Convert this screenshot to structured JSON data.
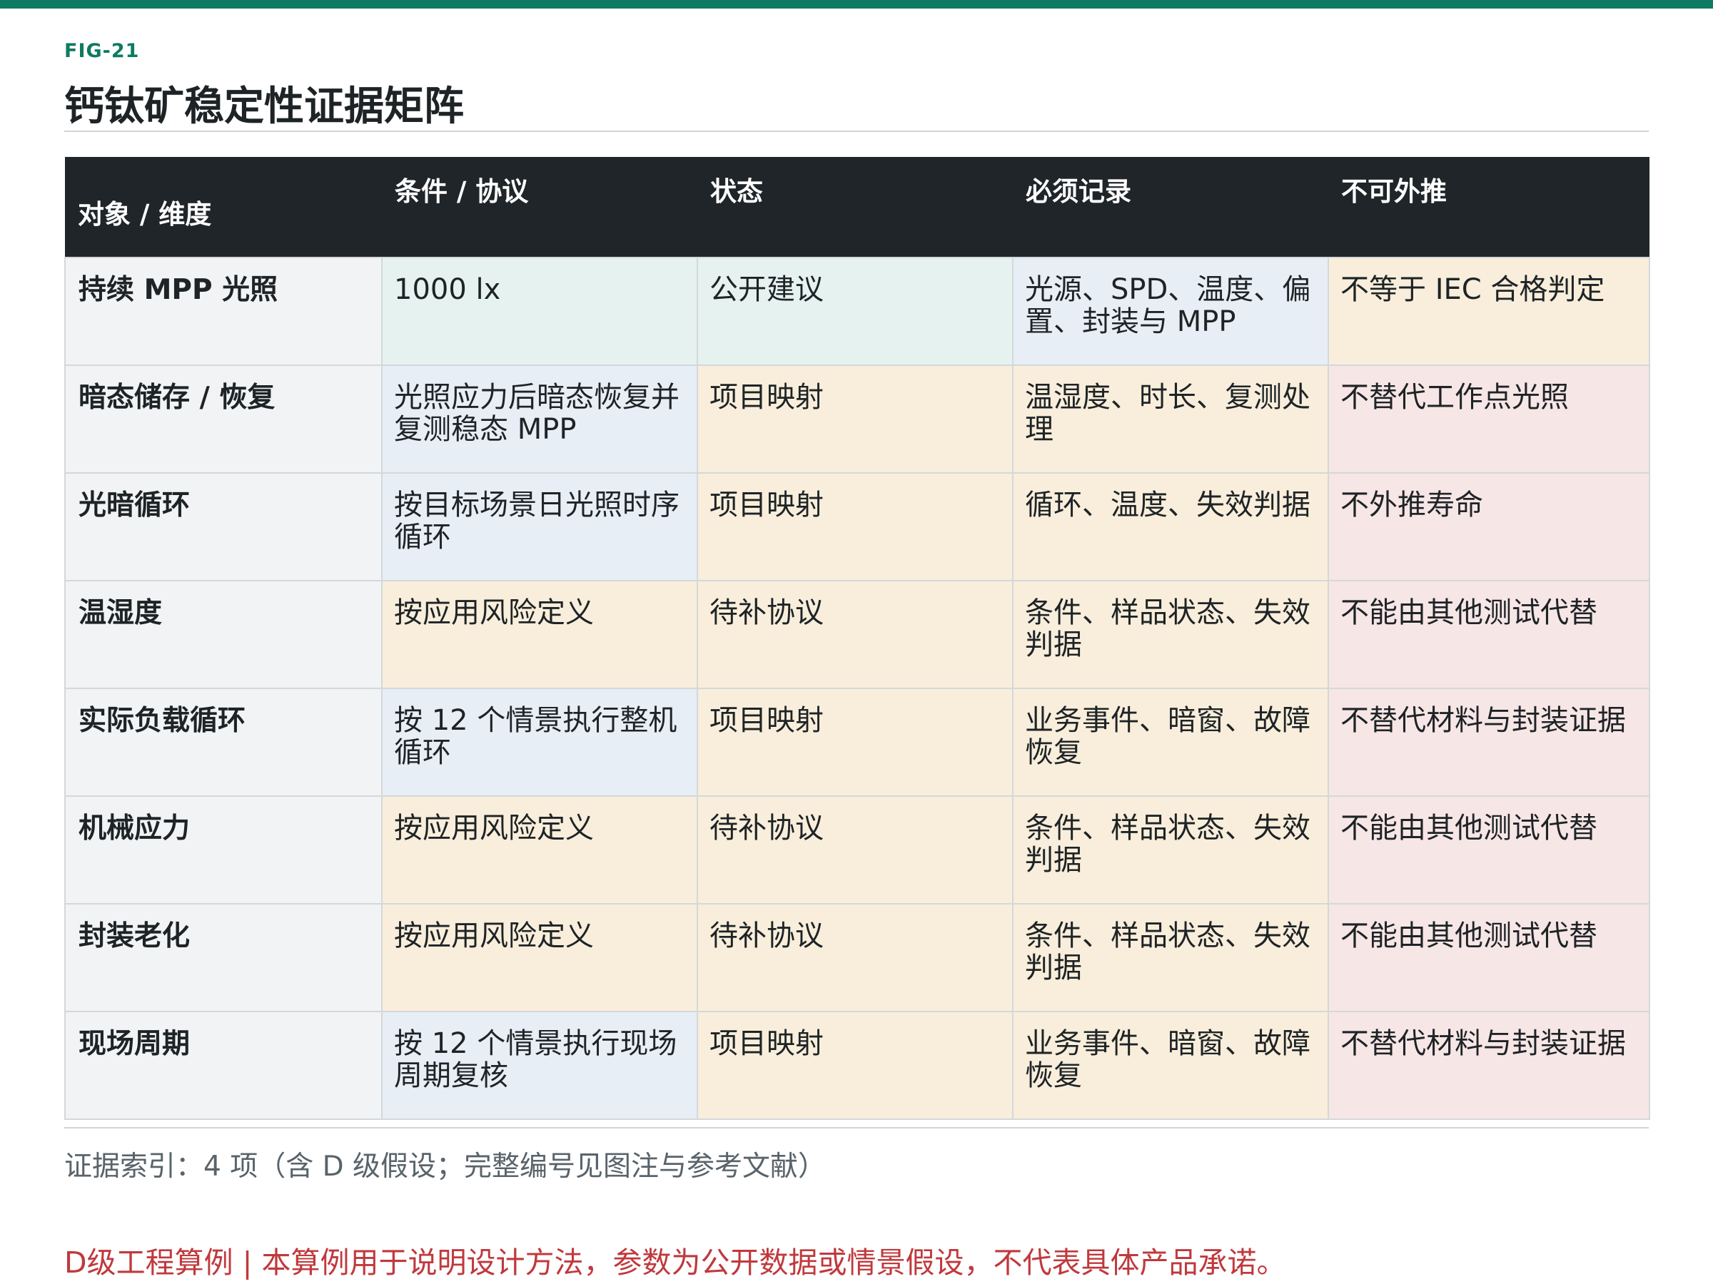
{
  "figure": {
    "label": "FIG-21",
    "title": "钙钛矿稳定性证据矩阵"
  },
  "colors": {
    "accent": "#0f7a62",
    "header_bg": "#1f2528",
    "teal": "#e6f2ef",
    "blue": "#e7eef6",
    "cream": "#f8eedb",
    "pink": "#f7e6e6",
    "disclaimer": "#c0393d"
  },
  "table": {
    "headers": [
      "对象 / 维度",
      "条件 / 协议",
      "状态",
      "必须记录",
      "不可外推"
    ],
    "rows": [
      {
        "dimension": "持续 MPP 光照",
        "condition": "1000 lx",
        "status": "公开建议",
        "record": "光源、SPD、温度、偏置、封装与 MPP",
        "limit": "不等于 IEC 合格判定",
        "tones": [
          "teal",
          "teal",
          "blue",
          "cream"
        ]
      },
      {
        "dimension": "暗态储存 / 恢复",
        "condition": "光照应力后暗态恢复并复测稳态 MPP",
        "status": "项目映射",
        "record": "温湿度、时长、复测处理",
        "limit": "不替代工作点光照",
        "tones": [
          "blue",
          "cream",
          "cream",
          "pink"
        ]
      },
      {
        "dimension": "光暗循环",
        "condition": "按目标场景日光照时序循环",
        "status": "项目映射",
        "record": "循环、温度、失效判据",
        "limit": "不外推寿命",
        "tones": [
          "blue",
          "cream",
          "cream",
          "pink"
        ]
      },
      {
        "dimension": "温湿度",
        "condition": "按应用风险定义",
        "status": "待补协议",
        "record": "条件、样品状态、失效判据",
        "limit": "不能由其他测试代替",
        "tones": [
          "cream",
          "cream",
          "cream",
          "pink"
        ]
      },
      {
        "dimension": "实际负载循环",
        "condition": "按 12 个情景执行整机循环",
        "status": "项目映射",
        "record": "业务事件、暗窗、故障恢复",
        "limit": "不替代材料与封装证据",
        "tones": [
          "blue",
          "cream",
          "cream",
          "pink"
        ]
      },
      {
        "dimension": "机械应力",
        "condition": "按应用风险定义",
        "status": "待补协议",
        "record": "条件、样品状态、失效判据",
        "limit": "不能由其他测试代替",
        "tones": [
          "cream",
          "cream",
          "cream",
          "pink"
        ]
      },
      {
        "dimension": "封装老化",
        "condition": "按应用风险定义",
        "status": "待补协议",
        "record": "条件、样品状态、失效判据",
        "limit": "不能由其他测试代替",
        "tones": [
          "cream",
          "cream",
          "cream",
          "pink"
        ]
      },
      {
        "dimension": "现场周期",
        "condition": "按 12 个情景执行现场周期复核",
        "status": "项目映射",
        "record": "业务事件、暗窗、故障恢复",
        "limit": "不替代材料与封装证据",
        "tones": [
          "blue",
          "cream",
          "cream",
          "pink"
        ]
      }
    ]
  },
  "footer": {
    "evidence_index": "证据索引：4 项（含 D 级假设；完整编号见图注与参考文献）",
    "disclaimer": "D级工程算例 | 本算例用于说明设计方法，参数为公开数据或情景假设，不代表具体产品承诺。"
  }
}
